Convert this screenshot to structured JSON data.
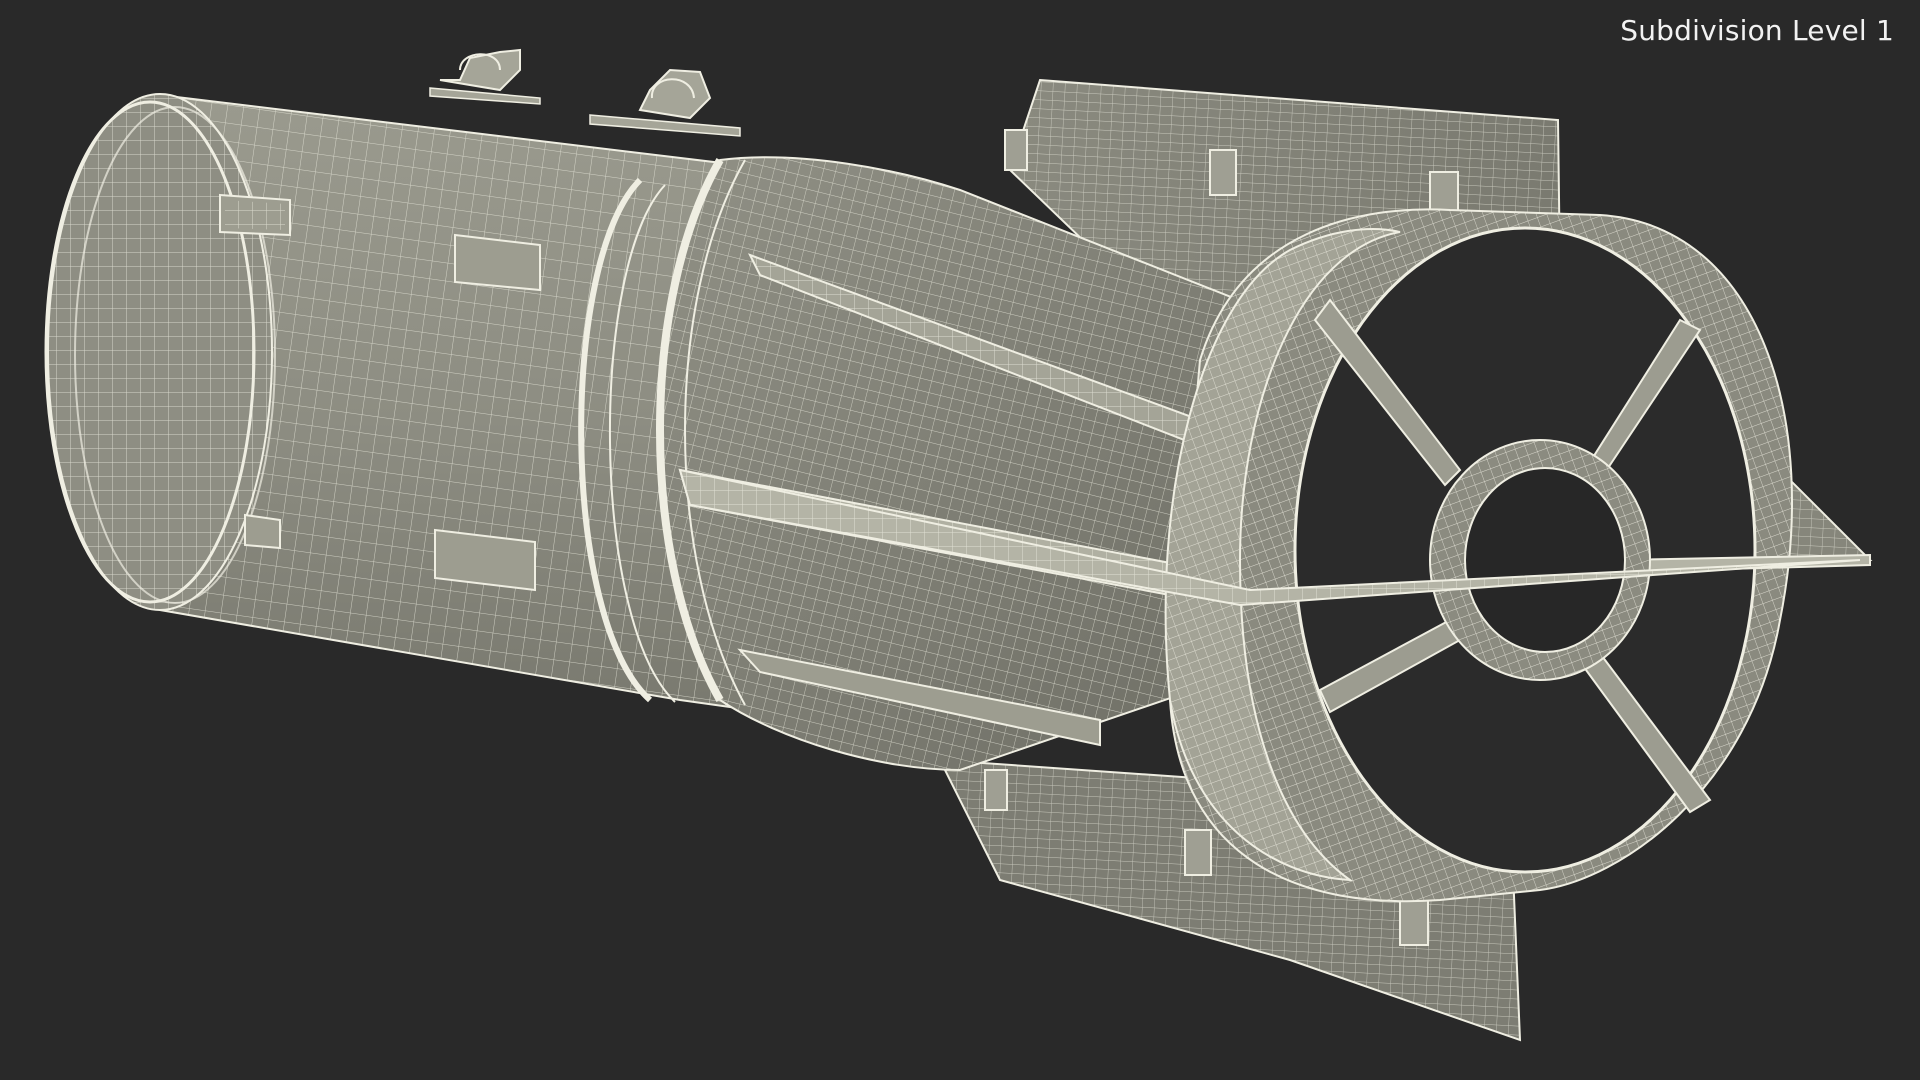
{
  "overlay": {
    "subdivision_label": "Subdivision Level 1"
  },
  "colors": {
    "background": "#292929",
    "mesh_fill": "#8f8f84",
    "mesh_fill_dark": "#6f6f66",
    "mesh_fill_light": "#a8a89c",
    "wire": "#efeee2",
    "label_text": "#f2f2f2"
  }
}
